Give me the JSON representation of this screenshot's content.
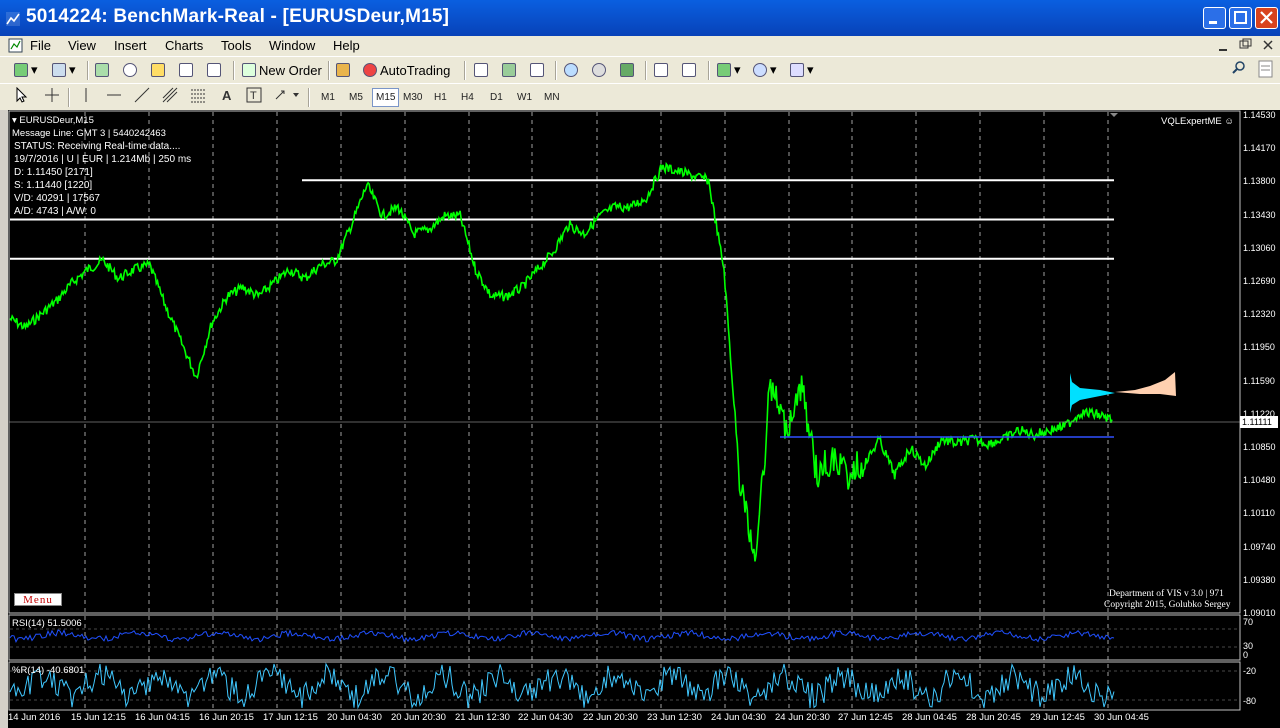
{
  "window": {
    "title": "5014224: BenchMark-Real - [EURUSDeur,M15]"
  },
  "menu": [
    "File",
    "View",
    "Insert",
    "Charts",
    "Tools",
    "Window",
    "Help"
  ],
  "toolbar": {
    "new_order": "New Order",
    "auto_trading": "AutoTrading",
    "timeframes": [
      "M1",
      "M5",
      "M15",
      "M30",
      "H1",
      "H4",
      "D1",
      "W1",
      "MN"
    ],
    "active_timeframe": "M15",
    "search_placeholder": ""
  },
  "chart": {
    "symbol_header": "EURUSDeur,M15",
    "info_lines": [
      "Message Line: GMT 3 | 5440242463",
      "STATUS:  Receiving Real-time data....",
      "19/7/2016 | U | EUR | 1.214Mb | 250 ms",
      "D: 1.11450  [2171]",
      "S: 1.11440  [1220]",
      "V/D: 40291 | 17567",
      "A/D: 4743 | A/W: 0"
    ],
    "expert_label": "VQLExpertME",
    "menu_button": "Menu",
    "copyright_line1": "Department of VIS  v 3.0 | 971",
    "copyright_line2": "Copyright 2015, Golubko Sergey",
    "current_price": "1.11111",
    "rsi_label": "RSI(14) 51.5006",
    "wpr_label": "%R(14) -40.6801",
    "rsi_levels": [
      "70",
      "30",
      "0"
    ],
    "wpr_levels": [
      "-20",
      "-80"
    ],
    "colors": {
      "background": "#000000",
      "price_line": "#00ff00",
      "level_lines": "#ffffff",
      "support_line": "#3050ff",
      "rsi_line": "#2050ff",
      "wpr_line": "#40c8ff",
      "profile_cyan": "#00e0ff",
      "profile_peach": "#ffd0b0"
    }
  },
  "chart_data": {
    "type": "line",
    "price_ticks": [
      "1.14530",
      "1.14170",
      "1.13800",
      "1.13430",
      "1.13060",
      "1.12690",
      "1.12320",
      "1.11950",
      "1.11590",
      "1.11220",
      "1.10850",
      "1.10480",
      "1.10110",
      "1.09740",
      "1.09380",
      "1.09010"
    ],
    "date_ticks": [
      "14 Jun 2016",
      "15 Jun 12:15",
      "16 Jun 04:15",
      "16 Jun 20:15",
      "17 Jun 12:15",
      "20 Jun 04:30",
      "20 Jun 20:30",
      "21 Jun 12:30",
      "22 Jun 04:30",
      "22 Jun 20:30",
      "23 Jun 12:30",
      "24 Jun 04:30",
      "24 Jun 20:30",
      "27 Jun 12:45",
      "28 Jun 04:45",
      "28 Jun 20:45",
      "29 Jun 12:45",
      "30 Jun 04:45"
    ],
    "series": [
      {
        "name": "EURUSDeur,M15",
        "y": [
          1.1225,
          1.1215,
          1.123,
          1.1245,
          1.1265,
          1.128,
          1.129,
          1.127,
          1.128,
          1.1285,
          1.124,
          1.12,
          1.116,
          1.122,
          1.125,
          1.126,
          1.125,
          1.1265,
          1.128,
          1.127,
          1.1285,
          1.129,
          1.133,
          1.1375,
          1.134,
          1.135,
          1.132,
          1.1325,
          1.134,
          1.134,
          1.128,
          1.125,
          1.125,
          1.126,
          1.128,
          1.13,
          1.133,
          1.132,
          1.134,
          1.135,
          1.135,
          1.136,
          1.1395,
          1.139,
          1.1385,
          1.138,
          1.128,
          1.105,
          1.095,
          1.115,
          1.11,
          1.115,
          1.105,
          1.107,
          1.105,
          1.106,
          1.109,
          1.105,
          1.108,
          1.106,
          1.109,
          1.1085,
          1.109,
          1.1085,
          1.109,
          1.11,
          1.1095,
          1.11,
          1.1105,
          1.112,
          1.1118,
          1.1112
        ]
      }
    ],
    "horizontal_levels": [
      1.138,
      1.1336,
      1.1292,
      1.11
    ],
    "ylim": [
      1.0901,
      1.1453
    ]
  }
}
